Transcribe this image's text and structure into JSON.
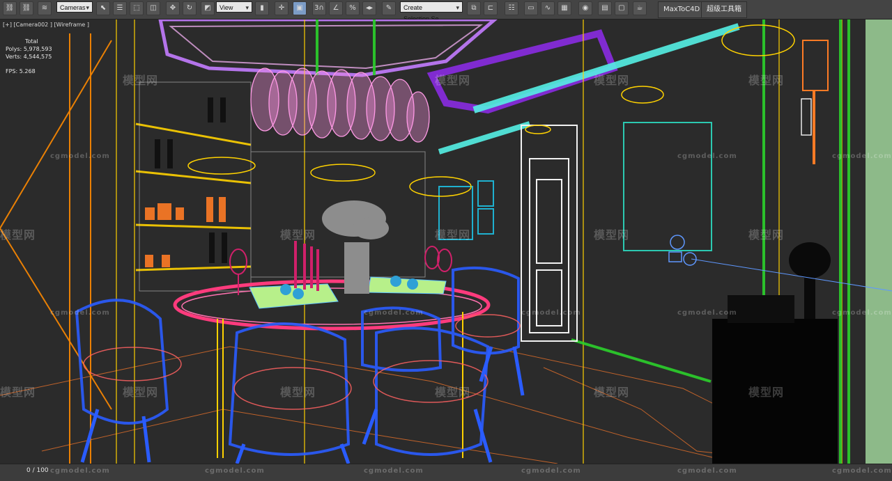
{
  "toolbar": {
    "camera_select": "Cameras",
    "view_select": "View",
    "selection_set_placeholder": "Create Selection Se",
    "maxtoc4d_label": "MaxToC4D",
    "toolbox_label": "超级工具箱",
    "icons": [
      "link-icon",
      "unlink-icon",
      "bind-spacewarp-icon",
      "select-object-icon",
      "select-by-name-icon",
      "rect-selection-icon",
      "window-crossing-icon",
      "move-icon",
      "rotate-icon",
      "scale-icon",
      "ref-coord-icon",
      "pivot-icon",
      "select-manipulate-icon",
      "keyboard-shortcut-icon",
      "snap-3-icon",
      "angle-snap-icon",
      "percent-snap-icon",
      "spinner-snap-icon",
      "edit-named-selections-icon",
      "mirror-icon",
      "align-icon",
      "layer-explorer-icon",
      "toggle-ribbon-icon",
      "curve-editor-icon",
      "schematic-view-icon",
      "material-editor-icon",
      "render-setup-icon",
      "rendered-frame-icon",
      "render-icon"
    ]
  },
  "viewport": {
    "label": "[+] [Camera002 ] [Wireframe ]",
    "stats": {
      "total_label": "Total",
      "polys_label": "Polys:",
      "polys_value": "5,978,593",
      "verts_label": "Verts:",
      "verts_value": "4,544,575",
      "fps_label": "FPS:",
      "fps_value": "5.268"
    },
    "watermark_logo": "模型网",
    "watermark_site": "cgmodel.com"
  },
  "timeline": {
    "frame_counter": "0 / 100"
  },
  "colors": {
    "toolbar_bg": "#444444",
    "viewport_bg": "#2b2b2b",
    "chandelier": "#ff9be6",
    "chairs": "#2a5cff",
    "table_edge": "#ff3b7d",
    "accent_green": "#2bd12b",
    "accent_cyan": "#55f0e5",
    "accent_purple": "#9a3cff",
    "wire_yellow": "#ffd200",
    "wire_orange": "#ff8a00"
  }
}
